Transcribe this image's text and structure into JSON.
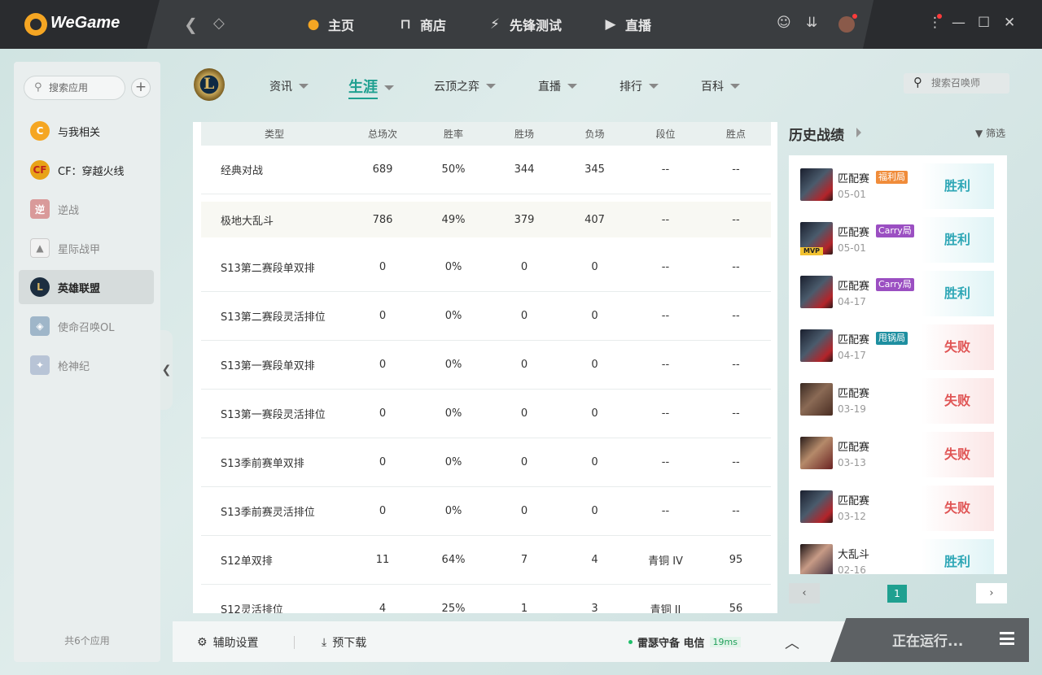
{
  "topbar": {
    "logo_text": "WeGame",
    "nav": [
      "主页",
      "商店",
      "先锋测试",
      "直播"
    ],
    "active_nav": "主页"
  },
  "sidebar": {
    "search_placeholder": "搜索应用",
    "items": [
      {
        "label": "与我相关",
        "icon": "related-icon"
      },
      {
        "label": "CF：穿越火线",
        "icon": "cf-icon"
      },
      {
        "label": "逆战",
        "icon": "nizhan-icon"
      },
      {
        "label": "星际战甲",
        "icon": "warframe-icon"
      },
      {
        "label": "英雄联盟",
        "icon": "lol-icon"
      },
      {
        "label": "使命召唤OL",
        "icon": "codol-icon"
      },
      {
        "label": "枪神纪",
        "icon": "qsj-icon"
      }
    ],
    "footer": "共6个应用"
  },
  "main_tabs": [
    "资讯",
    "生涯",
    "云顶之弈",
    "直播",
    "排行",
    "百科"
  ],
  "active_tab": "生涯",
  "summoner_search_placeholder": "搜索召唤师",
  "stats_table": {
    "headers": [
      "类型",
      "总场次",
      "胜率",
      "胜场",
      "负场",
      "段位",
      "胜点"
    ],
    "rows": [
      [
        "经典对战",
        "689",
        "50%",
        "344",
        "345",
        "--",
        "--"
      ],
      [
        "极地大乱斗",
        "786",
        "49%",
        "379",
        "407",
        "--",
        "--"
      ],
      [
        "S13第二赛段单双排",
        "0",
        "0%",
        "0",
        "0",
        "--",
        "--"
      ],
      [
        "S13第二赛段灵活排位",
        "0",
        "0%",
        "0",
        "0",
        "--",
        "--"
      ],
      [
        "S13第一赛段单双排",
        "0",
        "0%",
        "0",
        "0",
        "--",
        "--"
      ],
      [
        "S13第一赛段灵活排位",
        "0",
        "0%",
        "0",
        "0",
        "--",
        "--"
      ],
      [
        "S13季前赛单双排",
        "0",
        "0%",
        "0",
        "0",
        "--",
        "--"
      ],
      [
        "S13季前赛灵活排位",
        "0",
        "0%",
        "0",
        "0",
        "--",
        "--"
      ],
      [
        "S12单双排",
        "11",
        "64%",
        "7",
        "4",
        "青铜 IV",
        "95"
      ],
      [
        "S12灵活排位",
        "4",
        "25%",
        "1",
        "3",
        "青铜 II",
        "56"
      ]
    ]
  },
  "history": {
    "title": "历史战绩",
    "filter_label": "筛选",
    "matches": [
      {
        "mode": "匹配赛",
        "tag": "福利局",
        "tag_color": "#f08c3a",
        "date": "05-01",
        "result": "胜利",
        "win": true,
        "mvp": false
      },
      {
        "mode": "匹配赛",
        "tag": "Carry局",
        "tag_color": "#9b4fc2",
        "date": "05-01",
        "result": "胜利",
        "win": true,
        "mvp": true,
        "mvp_label": "MVP"
      },
      {
        "mode": "匹配赛",
        "tag": "Carry局",
        "tag_color": "#9b4fc2",
        "date": "04-17",
        "result": "胜利",
        "win": true,
        "mvp": false
      },
      {
        "mode": "匹配赛",
        "tag": "甩锅局",
        "tag_color": "#1e8fa0",
        "date": "04-17",
        "result": "失败",
        "win": false,
        "mvp": false
      },
      {
        "mode": "匹配赛",
        "tag": "",
        "date": "03-19",
        "result": "失败",
        "win": false,
        "mvp": false
      },
      {
        "mode": "匹配赛",
        "tag": "",
        "date": "03-13",
        "result": "失败",
        "win": false,
        "mvp": false
      },
      {
        "mode": "匹配赛",
        "tag": "",
        "date": "03-12",
        "result": "失败",
        "win": false,
        "mvp": false
      },
      {
        "mode": "大乱斗",
        "tag": "",
        "date": "02-16",
        "result": "胜利",
        "win": true,
        "mvp": false
      }
    ],
    "page": "1"
  },
  "bottombar": {
    "assist_settings": "辅助设置",
    "predownload": "预下载",
    "server": "雷瑟守备 电信",
    "ping": "19ms",
    "run_status": "正在运行..."
  }
}
